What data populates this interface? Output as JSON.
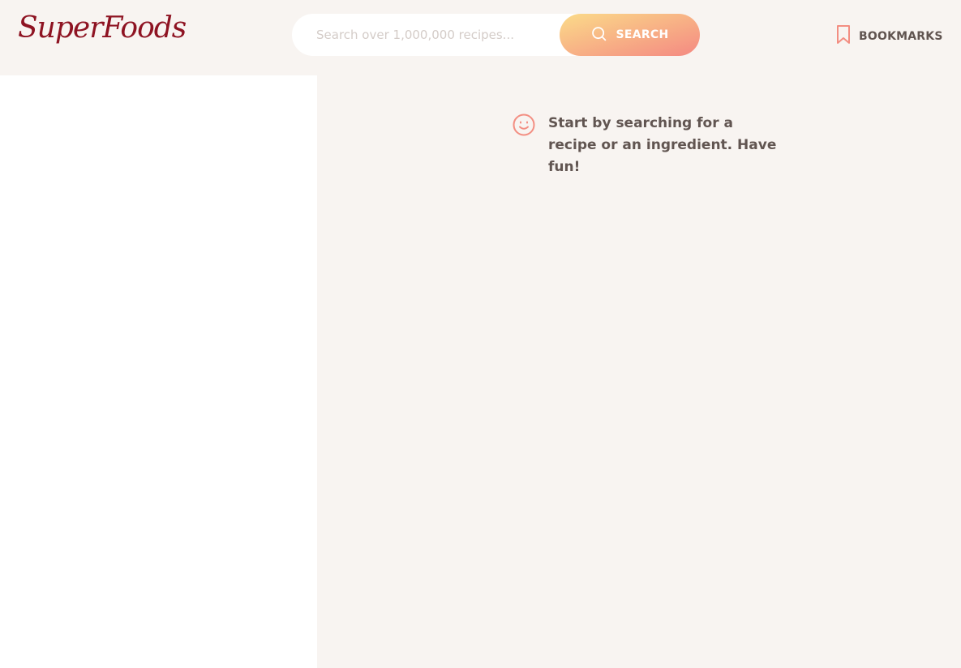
{
  "header": {
    "logo": "SuperFoods",
    "search": {
      "placeholder": "Search over 1,000,000 recipes...",
      "value": "",
      "button_label": "SEARCH",
      "button_icon": "search-icon"
    },
    "bookmarks": {
      "label": "BOOKMARKS",
      "icon": "bookmark-icon"
    }
  },
  "main": {
    "message": {
      "icon": "smile-icon",
      "text": "Start by searching for a recipe or an ingredient. Have fun!"
    }
  },
  "colors": {
    "logo": "#8e1322",
    "accent_start": "#fbdb89",
    "accent_end": "#f48982",
    "text": "#615551",
    "background": "#f8f4f1",
    "sidebar": "#ffffff"
  }
}
